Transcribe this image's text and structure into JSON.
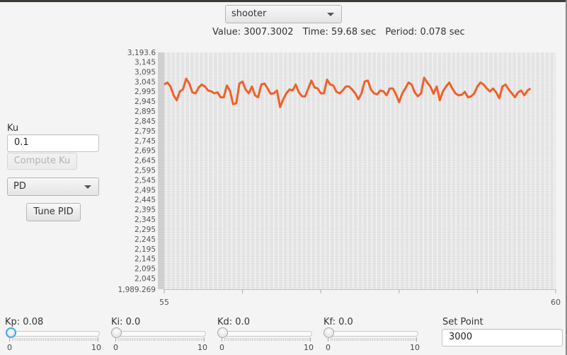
{
  "subsystem_select": {
    "value": "shooter"
  },
  "status": {
    "value": "Value: 3007.3002",
    "time": "Time: 59.68 sec",
    "period": "Period: 0.078 sec"
  },
  "ku": {
    "label": "Ku",
    "value": "0.1",
    "compute_button": "Compute Ku"
  },
  "controller_type_select": {
    "value": "PD"
  },
  "tune_button": "Tune PID",
  "sliders": [
    {
      "label": "Kp: 0.08",
      "value": 0.08,
      "min_label": "0",
      "max_label": "10",
      "min": 0,
      "max": 10
    },
    {
      "label": "Ki: 0.0",
      "value": 0.0,
      "min_label": "0",
      "max_label": "10",
      "min": 0,
      "max": 10
    },
    {
      "label": "Kd: 0.0",
      "value": 0.0,
      "min_label": "0",
      "max_label": "10",
      "min": 0,
      "max": 10
    },
    {
      "label": "Kf: 0.0",
      "value": 0.0,
      "min_label": "0",
      "max_label": "10",
      "min": 0,
      "max": 10
    }
  ],
  "set_point": {
    "label": "Set Point",
    "value": "3000"
  },
  "colors": {
    "series": "#f0602a",
    "plot_bg": "#e6e6e6",
    "focus": "#3ea7d9"
  },
  "chart_data": {
    "type": "line",
    "title": "",
    "xlabel": "",
    "ylabel": "",
    "xlim": [
      55,
      60
    ],
    "ylim": [
      1989.269,
      3193.6
    ],
    "x_tick_labels": [
      "55",
      "60"
    ],
    "x_ticks": [
      55,
      56,
      57,
      58,
      59,
      60
    ],
    "y_tick_labels": [
      "3,193.6",
      "3,145",
      "3,095",
      "3,045",
      "2,995",
      "2,945",
      "2,895",
      "2,845",
      "2,795",
      "2,745",
      "2,695",
      "2,645",
      "2,595",
      "2,545",
      "2,495",
      "2,445",
      "2,395",
      "2,345",
      "2,295",
      "2,245",
      "2,195",
      "2,145",
      "2,095",
      "2,045",
      "1,989.269"
    ],
    "y_ticks": [
      3193.6,
      3145,
      3095,
      3045,
      2995,
      2945,
      2895,
      2845,
      2795,
      2745,
      2695,
      2645,
      2595,
      2545,
      2495,
      2445,
      2395,
      2345,
      2295,
      2245,
      2195,
      2145,
      2095,
      2045,
      1989.269
    ],
    "grid": true,
    "legend": "none",
    "series": [
      {
        "name": "shooter",
        "x": [
          55.0,
          55.04,
          55.08,
          55.12,
          55.16,
          55.2,
          55.24,
          55.28,
          55.32,
          55.36,
          55.4,
          55.44,
          55.48,
          55.52,
          55.56,
          55.6,
          55.64,
          55.68,
          55.72,
          55.76,
          55.8,
          55.84,
          55.88,
          55.92,
          55.96,
          56.0,
          56.04,
          56.08,
          56.12,
          56.16,
          56.2,
          56.24,
          56.28,
          56.32,
          56.36,
          56.4,
          56.44,
          56.48,
          56.52,
          56.56,
          56.6,
          56.64,
          56.68,
          56.72,
          56.76,
          56.8,
          56.84,
          56.88,
          56.92,
          56.96,
          57.0,
          57.04,
          57.08,
          57.12,
          57.16,
          57.2,
          57.24,
          57.28,
          57.32,
          57.36,
          57.4,
          57.44,
          57.48,
          57.52,
          57.56,
          57.6,
          57.64,
          57.68,
          57.72,
          57.76,
          57.8,
          57.84,
          57.88,
          57.92,
          57.96,
          58.0,
          58.04,
          58.08,
          58.12,
          58.16,
          58.2,
          58.24,
          58.28,
          58.32,
          58.36,
          58.4,
          58.44,
          58.48,
          58.52,
          58.56,
          58.6,
          58.64,
          58.68,
          58.72,
          58.76,
          58.8,
          58.84,
          58.88,
          58.92,
          58.96,
          59.0,
          59.04,
          59.08,
          59.12,
          59.16,
          59.2,
          59.24,
          59.28,
          59.32,
          59.36,
          59.4,
          59.44,
          59.48,
          59.52,
          59.56,
          59.6,
          59.64,
          59.68
        ],
        "values": [
          3030,
          3040,
          3020,
          2975,
          2950,
          2995,
          3005,
          3060,
          3035,
          2990,
          2985,
          3015,
          3030,
          3020,
          3000,
          2995,
          2985,
          2990,
          2965,
          2965,
          3025,
          2998,
          2930,
          2935,
          3035,
          3045,
          3005,
          2985,
          3020,
          2975,
          2965,
          3030,
          3035,
          3010,
          2983,
          2985,
          3000,
          2915,
          2955,
          2985,
          3005,
          3000,
          3030,
          2990,
          2970,
          2970,
          3010,
          3050,
          3015,
          3010,
          2985,
          2985,
          3055,
          3030,
          3025,
          2993,
          2985,
          3000,
          3020,
          3020,
          3005,
          2985,
          2955,
          2985,
          3045,
          3050,
          3005,
          2985,
          2980,
          3000,
          2995,
          2975,
          3010,
          3010,
          2980,
          2940,
          2985,
          3010,
          3040,
          3030,
          2990,
          2970,
          2985,
          3065,
          3040,
          3020,
          2983,
          3020,
          2950,
          2995,
          3020,
          3040,
          3010,
          2985,
          2975,
          2978,
          2993,
          2965,
          2970,
          2985,
          3020,
          3040,
          3030,
          3010,
          2995,
          3010,
          2990,
          2960,
          3020,
          3030,
          3005,
          2985,
          2965,
          2990,
          3000,
          2975,
          3000,
          3010
        ]
      }
    ]
  }
}
